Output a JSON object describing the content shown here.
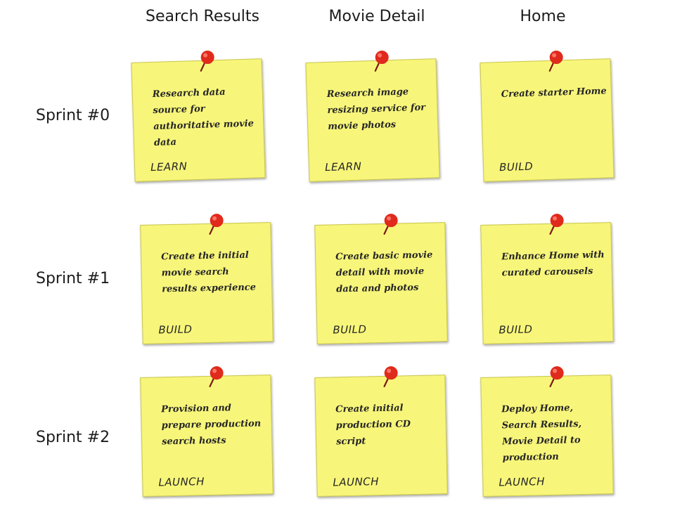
{
  "columns": [
    {
      "label": "Search Results"
    },
    {
      "label": "Movie Detail"
    },
    {
      "label": "Home"
    }
  ],
  "rows": [
    {
      "label": "Sprint #0",
      "notes": [
        {
          "text": "Research data source for authoritative movie data",
          "tag": "LEARN"
        },
        {
          "text": "Research image resizing service for movie photos",
          "tag": "LEARN"
        },
        {
          "text": "Create starter Home",
          "tag": "BUILD"
        }
      ]
    },
    {
      "label": "Sprint #1",
      "notes": [
        {
          "text": "Create the initial movie search results experience",
          "tag": "BUILD"
        },
        {
          "text": "Create basic movie detail with movie data and photos",
          "tag": "BUILD"
        },
        {
          "text": "Enhance Home with curated carousels",
          "tag": "BUILD"
        }
      ]
    },
    {
      "label": "Sprint #2",
      "notes": [
        {
          "text": "Provision and prepare production search hosts",
          "tag": "LAUNCH"
        },
        {
          "text": "Create initial production CD script",
          "tag": "LAUNCH"
        },
        {
          "text": "Deploy Home, Search Results, Movie Detail to production",
          "tag": "LAUNCH"
        }
      ]
    }
  ],
  "colors": {
    "note": "#f8f67a",
    "pin": "#e02a1c"
  },
  "icons": {
    "pin": "push-pin-icon"
  }
}
